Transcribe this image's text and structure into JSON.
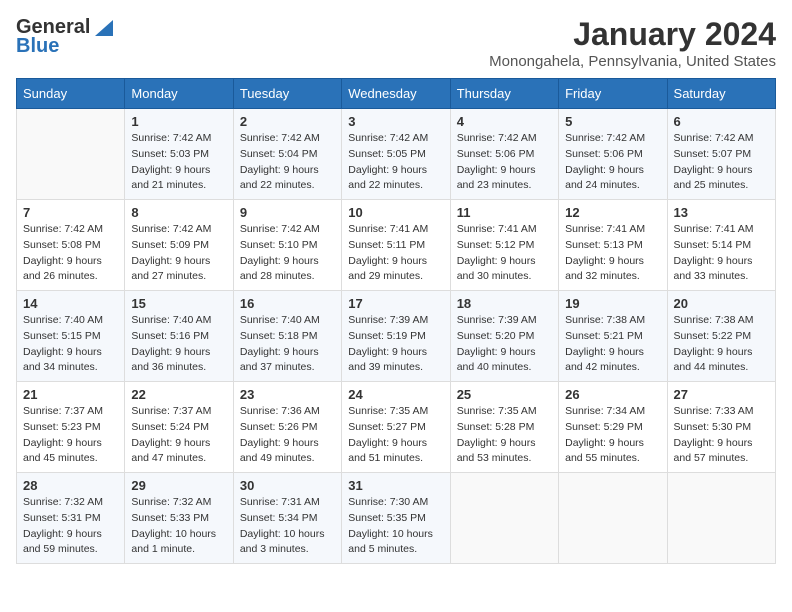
{
  "logo": {
    "general": "General",
    "blue": "Blue"
  },
  "title": "January 2024",
  "location": "Monongahela, Pennsylvania, United States",
  "days_of_week": [
    "Sunday",
    "Monday",
    "Tuesday",
    "Wednesday",
    "Thursday",
    "Friday",
    "Saturday"
  ],
  "weeks": [
    [
      {
        "day": "",
        "sunrise": "",
        "sunset": "",
        "daylight": ""
      },
      {
        "day": "1",
        "sunrise": "Sunrise: 7:42 AM",
        "sunset": "Sunset: 5:03 PM",
        "daylight": "Daylight: 9 hours and 21 minutes."
      },
      {
        "day": "2",
        "sunrise": "Sunrise: 7:42 AM",
        "sunset": "Sunset: 5:04 PM",
        "daylight": "Daylight: 9 hours and 22 minutes."
      },
      {
        "day": "3",
        "sunrise": "Sunrise: 7:42 AM",
        "sunset": "Sunset: 5:05 PM",
        "daylight": "Daylight: 9 hours and 22 minutes."
      },
      {
        "day": "4",
        "sunrise": "Sunrise: 7:42 AM",
        "sunset": "Sunset: 5:06 PM",
        "daylight": "Daylight: 9 hours and 23 minutes."
      },
      {
        "day": "5",
        "sunrise": "Sunrise: 7:42 AM",
        "sunset": "Sunset: 5:06 PM",
        "daylight": "Daylight: 9 hours and 24 minutes."
      },
      {
        "day": "6",
        "sunrise": "Sunrise: 7:42 AM",
        "sunset": "Sunset: 5:07 PM",
        "daylight": "Daylight: 9 hours and 25 minutes."
      }
    ],
    [
      {
        "day": "7",
        "sunrise": "Sunrise: 7:42 AM",
        "sunset": "Sunset: 5:08 PM",
        "daylight": "Daylight: 9 hours and 26 minutes."
      },
      {
        "day": "8",
        "sunrise": "Sunrise: 7:42 AM",
        "sunset": "Sunset: 5:09 PM",
        "daylight": "Daylight: 9 hours and 27 minutes."
      },
      {
        "day": "9",
        "sunrise": "Sunrise: 7:42 AM",
        "sunset": "Sunset: 5:10 PM",
        "daylight": "Daylight: 9 hours and 28 minutes."
      },
      {
        "day": "10",
        "sunrise": "Sunrise: 7:41 AM",
        "sunset": "Sunset: 5:11 PM",
        "daylight": "Daylight: 9 hours and 29 minutes."
      },
      {
        "day": "11",
        "sunrise": "Sunrise: 7:41 AM",
        "sunset": "Sunset: 5:12 PM",
        "daylight": "Daylight: 9 hours and 30 minutes."
      },
      {
        "day": "12",
        "sunrise": "Sunrise: 7:41 AM",
        "sunset": "Sunset: 5:13 PM",
        "daylight": "Daylight: 9 hours and 32 minutes."
      },
      {
        "day": "13",
        "sunrise": "Sunrise: 7:41 AM",
        "sunset": "Sunset: 5:14 PM",
        "daylight": "Daylight: 9 hours and 33 minutes."
      }
    ],
    [
      {
        "day": "14",
        "sunrise": "Sunrise: 7:40 AM",
        "sunset": "Sunset: 5:15 PM",
        "daylight": "Daylight: 9 hours and 34 minutes."
      },
      {
        "day": "15",
        "sunrise": "Sunrise: 7:40 AM",
        "sunset": "Sunset: 5:16 PM",
        "daylight": "Daylight: 9 hours and 36 minutes."
      },
      {
        "day": "16",
        "sunrise": "Sunrise: 7:40 AM",
        "sunset": "Sunset: 5:18 PM",
        "daylight": "Daylight: 9 hours and 37 minutes."
      },
      {
        "day": "17",
        "sunrise": "Sunrise: 7:39 AM",
        "sunset": "Sunset: 5:19 PM",
        "daylight": "Daylight: 9 hours and 39 minutes."
      },
      {
        "day": "18",
        "sunrise": "Sunrise: 7:39 AM",
        "sunset": "Sunset: 5:20 PM",
        "daylight": "Daylight: 9 hours and 40 minutes."
      },
      {
        "day": "19",
        "sunrise": "Sunrise: 7:38 AM",
        "sunset": "Sunset: 5:21 PM",
        "daylight": "Daylight: 9 hours and 42 minutes."
      },
      {
        "day": "20",
        "sunrise": "Sunrise: 7:38 AM",
        "sunset": "Sunset: 5:22 PM",
        "daylight": "Daylight: 9 hours and 44 minutes."
      }
    ],
    [
      {
        "day": "21",
        "sunrise": "Sunrise: 7:37 AM",
        "sunset": "Sunset: 5:23 PM",
        "daylight": "Daylight: 9 hours and 45 minutes."
      },
      {
        "day": "22",
        "sunrise": "Sunrise: 7:37 AM",
        "sunset": "Sunset: 5:24 PM",
        "daylight": "Daylight: 9 hours and 47 minutes."
      },
      {
        "day": "23",
        "sunrise": "Sunrise: 7:36 AM",
        "sunset": "Sunset: 5:26 PM",
        "daylight": "Daylight: 9 hours and 49 minutes."
      },
      {
        "day": "24",
        "sunrise": "Sunrise: 7:35 AM",
        "sunset": "Sunset: 5:27 PM",
        "daylight": "Daylight: 9 hours and 51 minutes."
      },
      {
        "day": "25",
        "sunrise": "Sunrise: 7:35 AM",
        "sunset": "Sunset: 5:28 PM",
        "daylight": "Daylight: 9 hours and 53 minutes."
      },
      {
        "day": "26",
        "sunrise": "Sunrise: 7:34 AM",
        "sunset": "Sunset: 5:29 PM",
        "daylight": "Daylight: 9 hours and 55 minutes."
      },
      {
        "day": "27",
        "sunrise": "Sunrise: 7:33 AM",
        "sunset": "Sunset: 5:30 PM",
        "daylight": "Daylight: 9 hours and 57 minutes."
      }
    ],
    [
      {
        "day": "28",
        "sunrise": "Sunrise: 7:32 AM",
        "sunset": "Sunset: 5:31 PM",
        "daylight": "Daylight: 9 hours and 59 minutes."
      },
      {
        "day": "29",
        "sunrise": "Sunrise: 7:32 AM",
        "sunset": "Sunset: 5:33 PM",
        "daylight": "Daylight: 10 hours and 1 minute."
      },
      {
        "day": "30",
        "sunrise": "Sunrise: 7:31 AM",
        "sunset": "Sunset: 5:34 PM",
        "daylight": "Daylight: 10 hours and 3 minutes."
      },
      {
        "day": "31",
        "sunrise": "Sunrise: 7:30 AM",
        "sunset": "Sunset: 5:35 PM",
        "daylight": "Daylight: 10 hours and 5 minutes."
      },
      {
        "day": "",
        "sunrise": "",
        "sunset": "",
        "daylight": ""
      },
      {
        "day": "",
        "sunrise": "",
        "sunset": "",
        "daylight": ""
      },
      {
        "day": "",
        "sunrise": "",
        "sunset": "",
        "daylight": ""
      }
    ]
  ]
}
